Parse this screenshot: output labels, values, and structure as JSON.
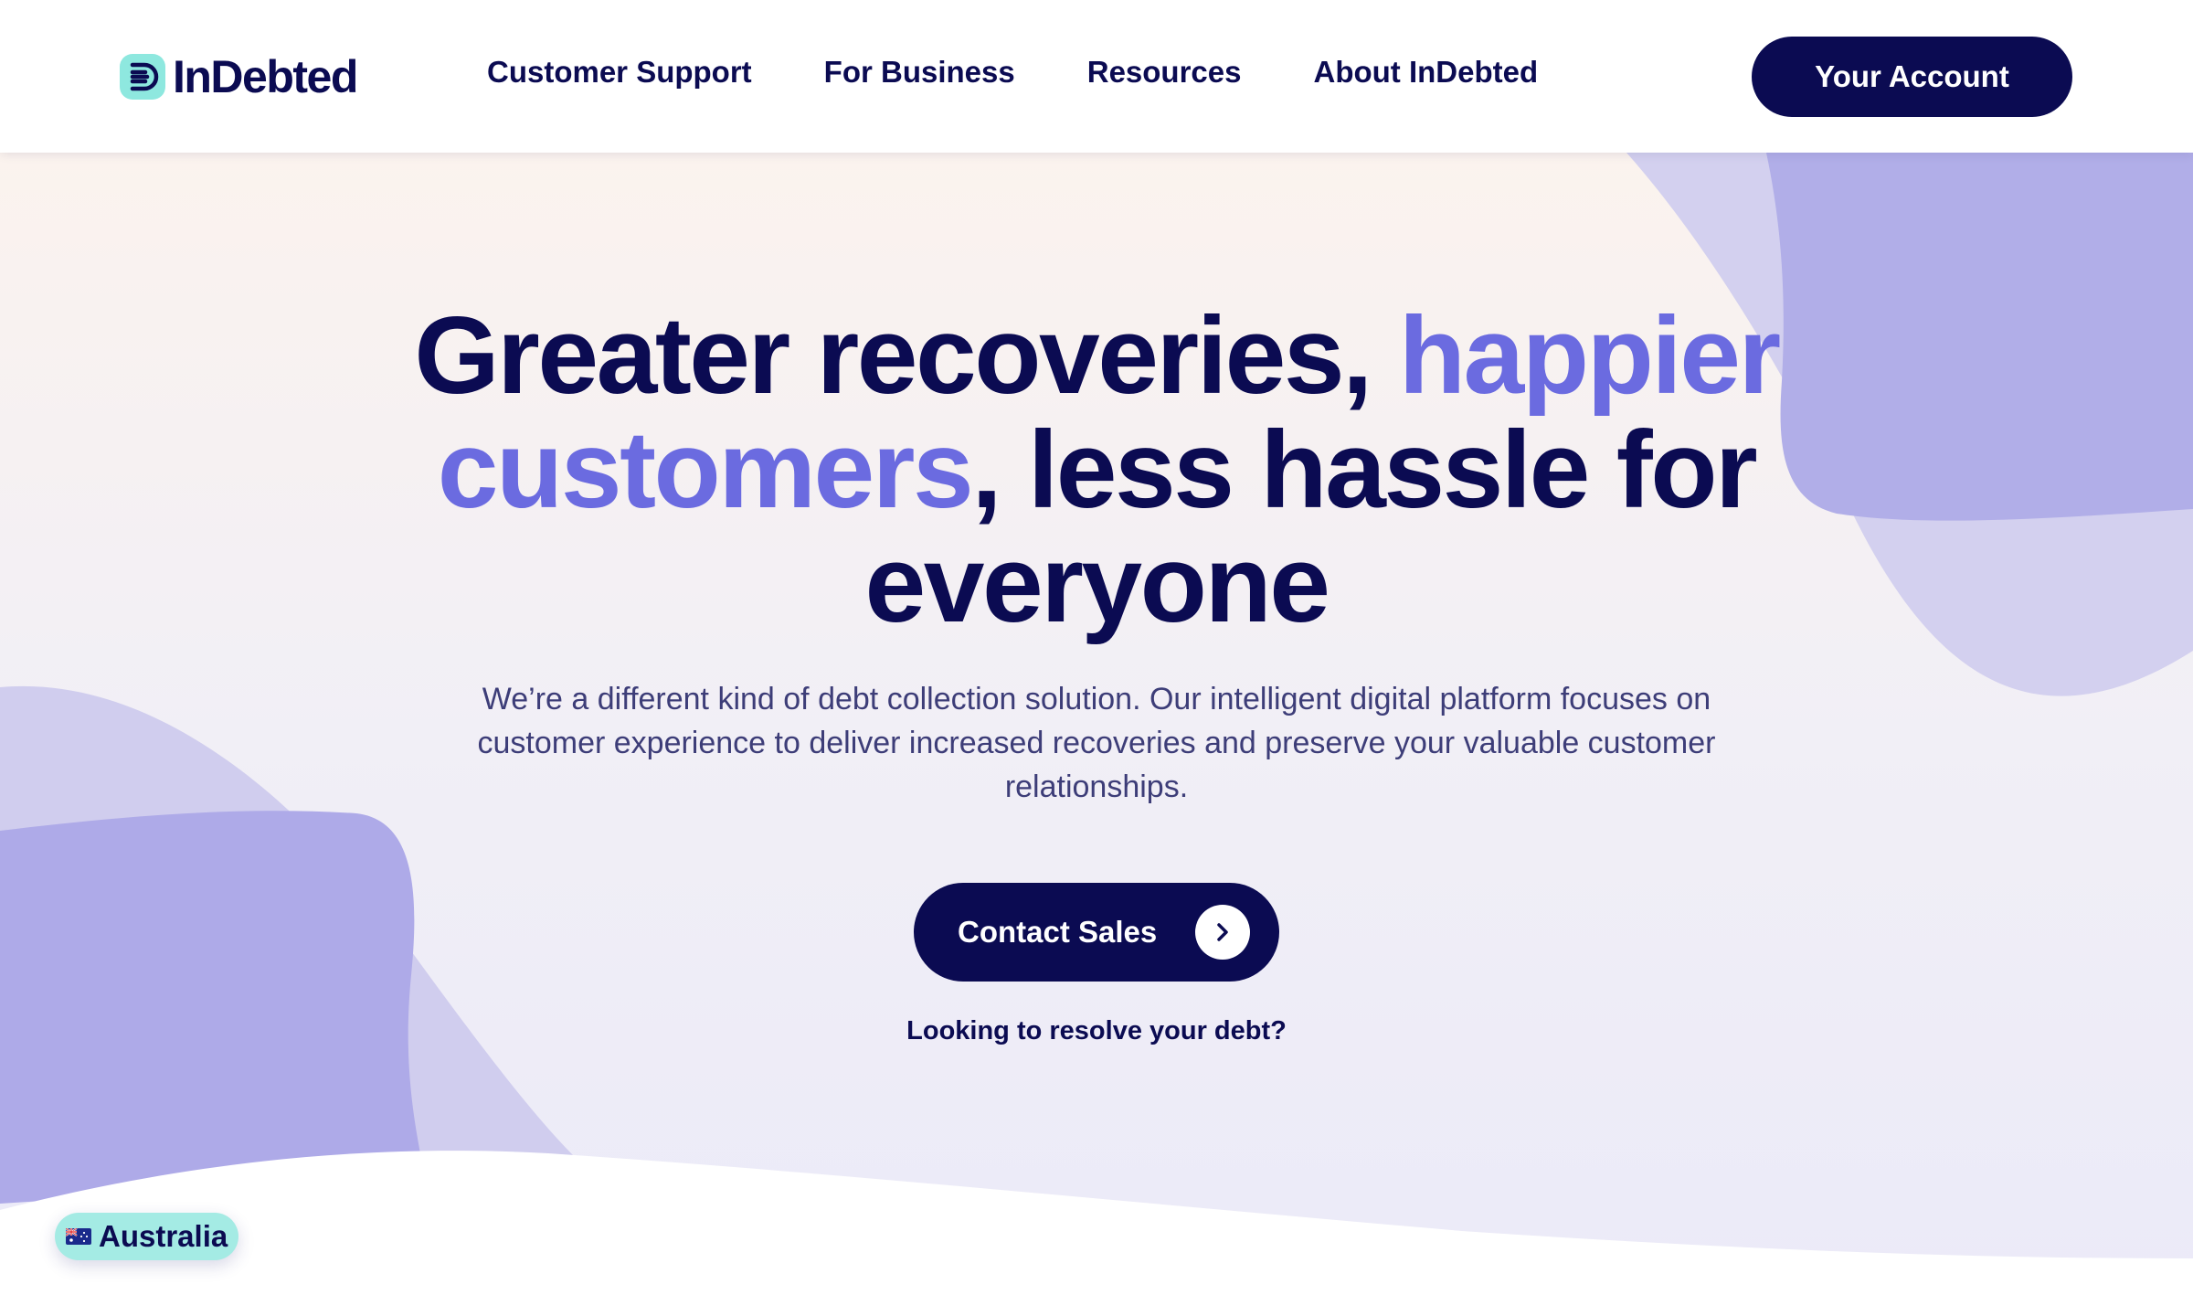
{
  "brand": {
    "name": "InDebted",
    "logo_icon": "indebted-logo-icon",
    "colors": {
      "navy": "#0b0b52",
      "accent_purple": "#6b6be0",
      "mint": "#8ee8df"
    }
  },
  "nav": {
    "items": [
      {
        "label": "Customer Support"
      },
      {
        "label": "For Business"
      },
      {
        "label": "Resources"
      },
      {
        "label": "About InDebted"
      }
    ],
    "account_button": "Your Account"
  },
  "hero": {
    "headline_part1": "Greater recoveries, ",
    "headline_accent": "happier customers",
    "headline_part2": ", less hassle for everyone",
    "subtext": "We’re a different kind of debt collection solution. Our intelligent digital platform focuses on customer experience to deliver increased recoveries and preserve your valuable customer relationships.",
    "cta_label": "Contact Sales",
    "cta_icon": "chevron-right-icon",
    "secondary_link": "Looking to resolve your debt?"
  },
  "region": {
    "label": "Australia",
    "flag_icon": "australia-flag-icon"
  }
}
